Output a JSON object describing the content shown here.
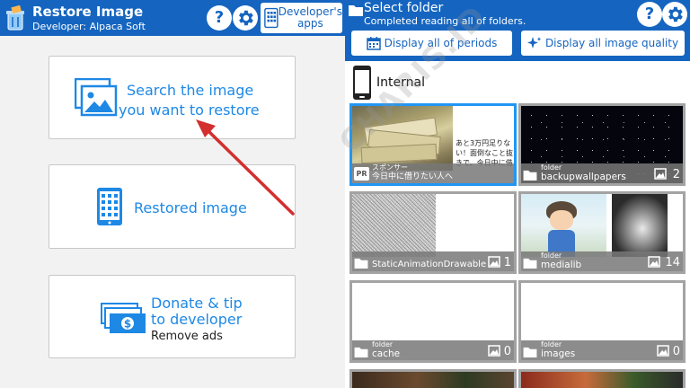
{
  "left": {
    "appbar": {
      "title": "Restore Image",
      "developer": "Developer: Alpaca Soft",
      "help_label": "?",
      "dev_apps_label": "Developer's apps"
    },
    "cards": {
      "search": {
        "line1": "Search the image",
        "line2": "you want to restore"
      },
      "restored": {
        "label": "Restored image"
      },
      "donate": {
        "line1": "Donate & tip",
        "line2": "to developer",
        "line3": "Remove ads"
      }
    }
  },
  "right": {
    "appbar": {
      "title": "Select folder",
      "subtitle": "Completed reading all of folders.",
      "help_label": "?",
      "periods_label": "Display all of periods",
      "quality_label": "Display all image quality"
    },
    "storage_label": "Internal",
    "ad": {
      "badge": "PR",
      "sponsor": "スポンサー",
      "caption": "今日中に借りたい人へ",
      "overlay_text": [
        "あと3万円足りな",
        "い！面倒なこと抜",
        "きで、今日中に借"
      ]
    },
    "folders": [
      {
        "kind": "folder",
        "name": "backupwallpapers",
        "count": "2"
      },
      {
        "kind": "",
        "name": "StaticAnimationDrawable",
        "count": "1"
      },
      {
        "kind": "folder",
        "name": "medialib",
        "count": "14"
      },
      {
        "kind": "folder",
        "name": "cache",
        "count": "0"
      },
      {
        "kind": "folder",
        "name": "images",
        "count": "0"
      }
    ]
  },
  "watermark": "CHARIS.ID",
  "colors": {
    "appbar": "#1565c0",
    "accent": "#1e88e5",
    "arrow": "#d32f2f",
    "selected_border": "#2196f3"
  }
}
